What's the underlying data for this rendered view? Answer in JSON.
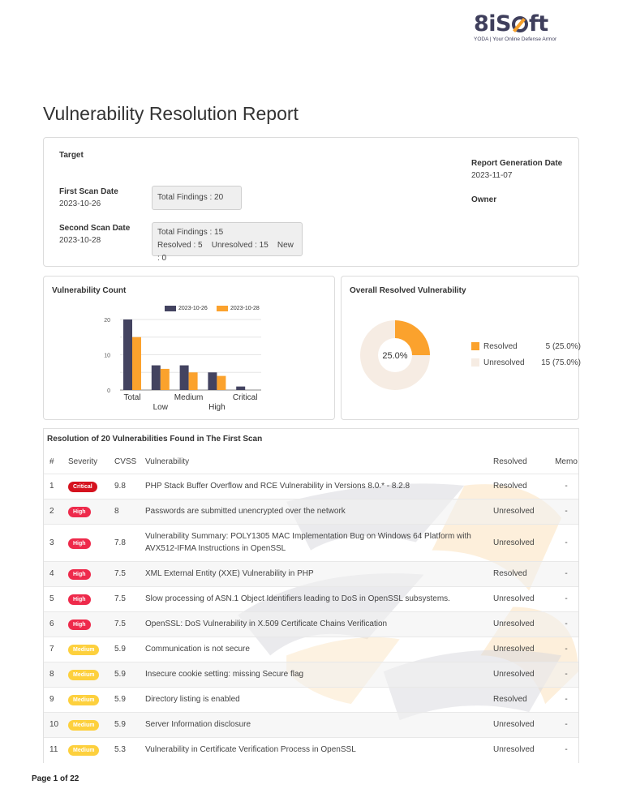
{
  "brand": {
    "name_left": "8iS",
    "name_right": "ft",
    "tagline": "YODA | Your Online Defense Armor",
    "colors": {
      "primary": "#3f3f5c",
      "accent": "#f7a12c"
    }
  },
  "page_title": "Vulnerability Resolution Report",
  "info": {
    "target_label": "Target",
    "target_value": "",
    "first_scan_label": "First Scan Date",
    "first_scan_date": "2023-10-26",
    "first_scan_findings": "Total Findings : 20",
    "second_scan_label": "Second Scan Date",
    "second_scan_date": "2023-10-28",
    "second_scan_findings": "Total Findings : 15",
    "second_scan_resolved": "Resolved : 5",
    "second_scan_unresolved": "Unresolved : 15",
    "second_scan_new": "New : 0",
    "report_date_label": "Report Generation Date",
    "report_date": "2023-11-07",
    "owner_label": "Owner",
    "owner_value": ""
  },
  "chart_data": [
    {
      "type": "bar",
      "title": "Vulnerability Count",
      "categories": [
        "Total",
        "Low",
        "Medium",
        "High",
        "Critical"
      ],
      "series": [
        {
          "name": "2023-10-26",
          "color": "#434360",
          "values": [
            20,
            7,
            7,
            5,
            1
          ]
        },
        {
          "name": "2023-10-28",
          "color": "#fba22d",
          "values": [
            15,
            6,
            5,
            4,
            0
          ]
        }
      ],
      "xlabel": "",
      "ylabel": "",
      "ylim": [
        0,
        20
      ],
      "yticks": [
        0,
        10,
        20
      ],
      "grid": true,
      "legend": "top"
    },
    {
      "type": "pie",
      "title": "Overall Resolved Vulnerability",
      "center_label": "25.0%",
      "slices": [
        {
          "name": "Resolved",
          "value": 5,
          "display": "5 (25.0%)",
          "color": "#fba22d"
        },
        {
          "name": "Unresolved",
          "value": 15,
          "display": "15 (75.0%)",
          "color": "#f6ece3"
        }
      ],
      "legend": "right"
    }
  ],
  "table": {
    "title": "Resolution of 20 Vulnerabilities Found in The First Scan",
    "headers": [
      "#",
      "Severity",
      "CVSS",
      "Vulnerability",
      "Resolved",
      "Memo"
    ],
    "rows": [
      {
        "num": "1",
        "severity": "Critical",
        "cvss": "9.8",
        "vulnerability": "PHP Stack Buffer Overflow and RCE Vulnerability in Versions 8.0.* - 8.2.8",
        "resolved": "Resolved",
        "memo": "-"
      },
      {
        "num": "2",
        "severity": "High",
        "cvss": "8",
        "vulnerability": "Passwords are submitted unencrypted over the network",
        "resolved": "Unresolved",
        "memo": "-"
      },
      {
        "num": "3",
        "severity": "High",
        "cvss": "7.8",
        "vulnerability": "Vulnerability Summary: POLY1305 MAC Implementation Bug on Windows 64 Platform with AVX512-IFMA Instructions in OpenSSL",
        "resolved": "Unresolved",
        "memo": "-"
      },
      {
        "num": "4",
        "severity": "High",
        "cvss": "7.5",
        "vulnerability": "XML External Entity (XXE) Vulnerability in PHP",
        "resolved": "Resolved",
        "memo": "-"
      },
      {
        "num": "5",
        "severity": "High",
        "cvss": "7.5",
        "vulnerability": "Slow processing of ASN.1 Object Identifiers leading to DoS in OpenSSL subsystems.",
        "resolved": "Unresolved",
        "memo": "-"
      },
      {
        "num": "6",
        "severity": "High",
        "cvss": "7.5",
        "vulnerability": "OpenSSL: DoS Vulnerability in X.509 Certificate Chains Verification",
        "resolved": "Unresolved",
        "memo": "-"
      },
      {
        "num": "7",
        "severity": "Medium",
        "cvss": "5.9",
        "vulnerability": "Communication is not secure",
        "resolved": "Unresolved",
        "memo": "-"
      },
      {
        "num": "8",
        "severity": "Medium",
        "cvss": "5.9",
        "vulnerability": "Insecure cookie setting: missing Secure flag",
        "resolved": "Unresolved",
        "memo": "-"
      },
      {
        "num": "9",
        "severity": "Medium",
        "cvss": "5.9",
        "vulnerability": "Directory listing is enabled",
        "resolved": "Resolved",
        "memo": "-"
      },
      {
        "num": "10",
        "severity": "Medium",
        "cvss": "5.9",
        "vulnerability": "Server Information disclosure",
        "resolved": "Unresolved",
        "memo": "-"
      },
      {
        "num": "11",
        "severity": "Medium",
        "cvss": "5.3",
        "vulnerability": "Vulnerability in Certificate Verification Process in OpenSSL",
        "resolved": "Unresolved",
        "memo": "-"
      }
    ]
  },
  "footer": {
    "page_label": "Page 1 of 22"
  }
}
